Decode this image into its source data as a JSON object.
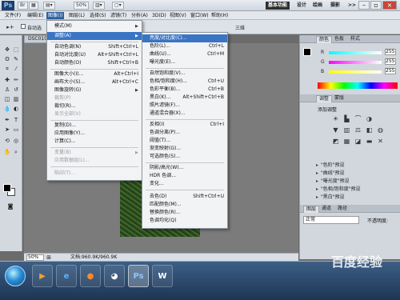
{
  "titlebar": {
    "logo": "Ps",
    "zoom": "50%",
    "workspaces": [
      "基本功能",
      "设计",
      "绘画",
      "摄影"
    ],
    "more": ">>"
  },
  "menubar": {
    "items": [
      "文件(F)",
      "编辑(E)",
      "图像(I)",
      "图层(L)",
      "选择(S)",
      "滤镜(T)",
      "分析(A)",
      "3D(D)",
      "视图(V)",
      "窗口(W)",
      "帮助(H)"
    ],
    "active_index": 2
  },
  "optbar": {
    "auto_select": "自动选",
    "right_text": "三维"
  },
  "doc": {
    "tab": "DSC010",
    "zoom": "50%",
    "info": "文档:960.9K/960.9K"
  },
  "image_menu": {
    "items": [
      {
        "label": "模式(M)",
        "shortcut": "",
        "submenu": true,
        "disabled": false
      },
      {
        "label": "调整(A)",
        "shortcut": "",
        "submenu": true,
        "disabled": false,
        "highlight": true
      },
      {
        "label": "自动色调(N)",
        "shortcut": "Shift+Ctrl+L",
        "disabled": false
      },
      {
        "label": "自动对比度(U)",
        "shortcut": "Alt+Shift+Ctrl+L",
        "disabled": false
      },
      {
        "label": "自动颜色(O)",
        "shortcut": "Shift+Ctrl+B",
        "disabled": false
      },
      {
        "label": "图像大小(I)...",
        "shortcut": "Alt+Ctrl+I",
        "disabled": false
      },
      {
        "label": "画布大小(S)...",
        "shortcut": "Alt+Ctrl+C",
        "disabled": false
      },
      {
        "label": "图像旋转(G)",
        "shortcut": "",
        "submenu": true,
        "disabled": false
      },
      {
        "label": "裁剪(P)",
        "shortcut": "",
        "disabled": true
      },
      {
        "label": "裁切(R)...",
        "shortcut": "",
        "disabled": false
      },
      {
        "label": "显示全部(V)",
        "shortcut": "",
        "disabled": true
      },
      {
        "label": "复制(D)...",
        "shortcut": "",
        "disabled": false
      },
      {
        "label": "应用图像(Y)...",
        "shortcut": "",
        "disabled": false
      },
      {
        "label": "计算(C)...",
        "shortcut": "",
        "disabled": false
      },
      {
        "label": "变量(B)",
        "shortcut": "",
        "submenu": true,
        "disabled": true
      },
      {
        "label": "应用数据组(L)...",
        "shortcut": "",
        "disabled": true
      },
      {
        "label": "陷印(T)...",
        "shortcut": "",
        "disabled": true
      }
    ]
  },
  "adjust_menu": {
    "items": [
      {
        "label": "亮度/对比度(C)...",
        "shortcut": "",
        "highlight": true
      },
      {
        "label": "色阶(L)...",
        "shortcut": "Ctrl+L"
      },
      {
        "label": "曲线(U)...",
        "shortcut": "Ctrl+M"
      },
      {
        "label": "曝光度(E)...",
        "shortcut": ""
      },
      {
        "label": "自然饱和度(V)...",
        "shortcut": ""
      },
      {
        "label": "色相/饱和度(H)...",
        "shortcut": "Ctrl+U"
      },
      {
        "label": "色彩平衡(B)...",
        "shortcut": "Ctrl+B"
      },
      {
        "label": "黑白(K)...",
        "shortcut": "Alt+Shift+Ctrl+B"
      },
      {
        "label": "照片滤镜(F)...",
        "shortcut": ""
      },
      {
        "label": "通道混合器(X)...",
        "shortcut": ""
      },
      {
        "label": "反相(I)",
        "shortcut": "Ctrl+I"
      },
      {
        "label": "色调分离(P)...",
        "shortcut": ""
      },
      {
        "label": "阈值(T)...",
        "shortcut": ""
      },
      {
        "label": "渐变映射(G)...",
        "shortcut": ""
      },
      {
        "label": "可选颜色(S)...",
        "shortcut": ""
      },
      {
        "label": "阴影/高光(W)...",
        "shortcut": ""
      },
      {
        "label": "HDR 色调...",
        "shortcut": ""
      },
      {
        "label": "变化...",
        "shortcut": ""
      },
      {
        "label": "去色(D)",
        "shortcut": "Shift+Ctrl+U"
      },
      {
        "label": "匹配颜色(M)...",
        "shortcut": ""
      },
      {
        "label": "替换颜色(R)...",
        "shortcut": ""
      },
      {
        "label": "色调均化(Q)",
        "shortcut": ""
      }
    ]
  },
  "panels": {
    "color_tabs": [
      "颜色",
      "色板",
      "样式"
    ],
    "sliders": [
      {
        "label": "R",
        "value": "255"
      },
      {
        "label": "G",
        "value": "255"
      },
      {
        "label": "B",
        "value": "255"
      }
    ],
    "adjust_tabs": [
      "调整",
      "蒙版"
    ],
    "adjust_title": "添加调整",
    "presets": [
      "\"色阶\"预设",
      "\"曲线\"预设",
      "\"曝光度\"预设",
      "\"色相/饱和度\"预设",
      "\"黑白\"预设"
    ],
    "layers_tabs": [
      "图层",
      "通道",
      "路径"
    ],
    "blend_mode": "正常",
    "opacity_label": "不透明度:"
  },
  "taskbar": {
    "apps": [
      {
        "name": "media-player",
        "glyph": "▶",
        "color": "#f0a030"
      },
      {
        "name": "ie",
        "glyph": "e",
        "color": "#58b4ff"
      },
      {
        "name": "firefox",
        "glyph": "●",
        "color": "#ff8a2a"
      },
      {
        "name": "qq",
        "glyph": "◕",
        "color": "#ffffff"
      },
      {
        "name": "photoshop",
        "glyph": "Ps",
        "color": "#8fc3ff",
        "active": true
      },
      {
        "name": "wps",
        "glyph": "W",
        "color": "#ffffff"
      }
    ]
  },
  "watermark": "百度经验"
}
